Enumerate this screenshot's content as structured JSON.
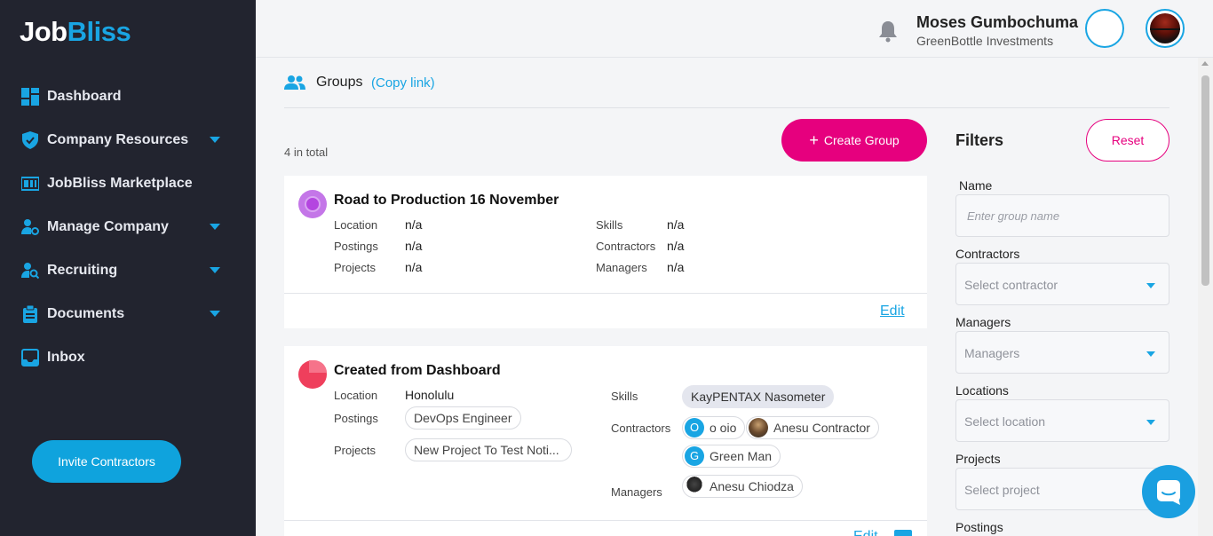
{
  "brand": {
    "logo_part1": "Job",
    "logo_part2": "Bliss"
  },
  "sidebar": {
    "items": [
      {
        "label": "Dashboard",
        "icon": "dashboard-icon",
        "has_submenu": false
      },
      {
        "label": "Company Resources",
        "icon": "shield-icon",
        "has_submenu": true
      },
      {
        "label": "JobBliss Marketplace",
        "icon": "id-card-icon",
        "has_submenu": false
      },
      {
        "label": "Manage Company",
        "icon": "user-gear-icon",
        "has_submenu": true
      },
      {
        "label": "Recruiting",
        "icon": "user-search-icon",
        "has_submenu": true
      },
      {
        "label": "Documents",
        "icon": "clipboard-icon",
        "has_submenu": true
      },
      {
        "label": "Inbox",
        "icon": "inbox-icon",
        "has_submenu": false
      }
    ],
    "invite_label": "Invite Contractors"
  },
  "header": {
    "user_name": "Moses Gumbochuma",
    "company": "GreenBottle Investments"
  },
  "page": {
    "title": "Groups",
    "copy_link": "(Copy link)",
    "total": "4 in total",
    "create_label": "Create Group"
  },
  "groups": [
    {
      "name": "Road to Production 16 November",
      "icon_color": "#b445e0",
      "labels": {
        "location": "Location",
        "postings": "Postings",
        "projects": "Projects",
        "skills": "Skills",
        "contractors": "Contractors",
        "managers": "Managers"
      },
      "location": "n/a",
      "postings": "n/a",
      "projects": "n/a",
      "skills": "n/a",
      "contractors": "n/a",
      "managers": "n/a",
      "edit_label": "Edit"
    },
    {
      "name": "Created from Dashboard",
      "icon_color": "#ef3f5c",
      "labels": {
        "location": "Location",
        "postings": "Postings",
        "projects": "Projects",
        "skills": "Skills",
        "contractors": "Contractors",
        "managers": "Managers"
      },
      "location": "Honolulu",
      "postings": [
        "DevOps Engineer"
      ],
      "projects": [
        "New Project To Test Noti..."
      ],
      "skills": [
        "KayPENTAX Nasometer"
      ],
      "contractors": [
        {
          "initial": "O",
          "name": "o oio"
        },
        {
          "initial": "",
          "name": "Anesu Contractor"
        },
        {
          "initial": "G",
          "name": "Green Man"
        }
      ],
      "managers": [
        {
          "initial": "",
          "name": "Anesu Chiodza"
        }
      ],
      "edit_label": "Edit"
    }
  ],
  "filters": {
    "title": "Filters",
    "reset_label": "Reset",
    "name_label": "Name",
    "name_placeholder": "Enter group name",
    "contractors_label": "Contractors",
    "contractors_placeholder": "Select contractor",
    "managers_label": "Managers",
    "managers_placeholder": "Managers",
    "locations_label": "Locations",
    "locations_placeholder": "Select location",
    "projects_label": "Projects",
    "projects_placeholder": "Select project",
    "postings_label": "Postings"
  },
  "colors": {
    "accent": "#19a5e3",
    "primary": "#e6007e",
    "sidebar_bg": "#22242f"
  }
}
